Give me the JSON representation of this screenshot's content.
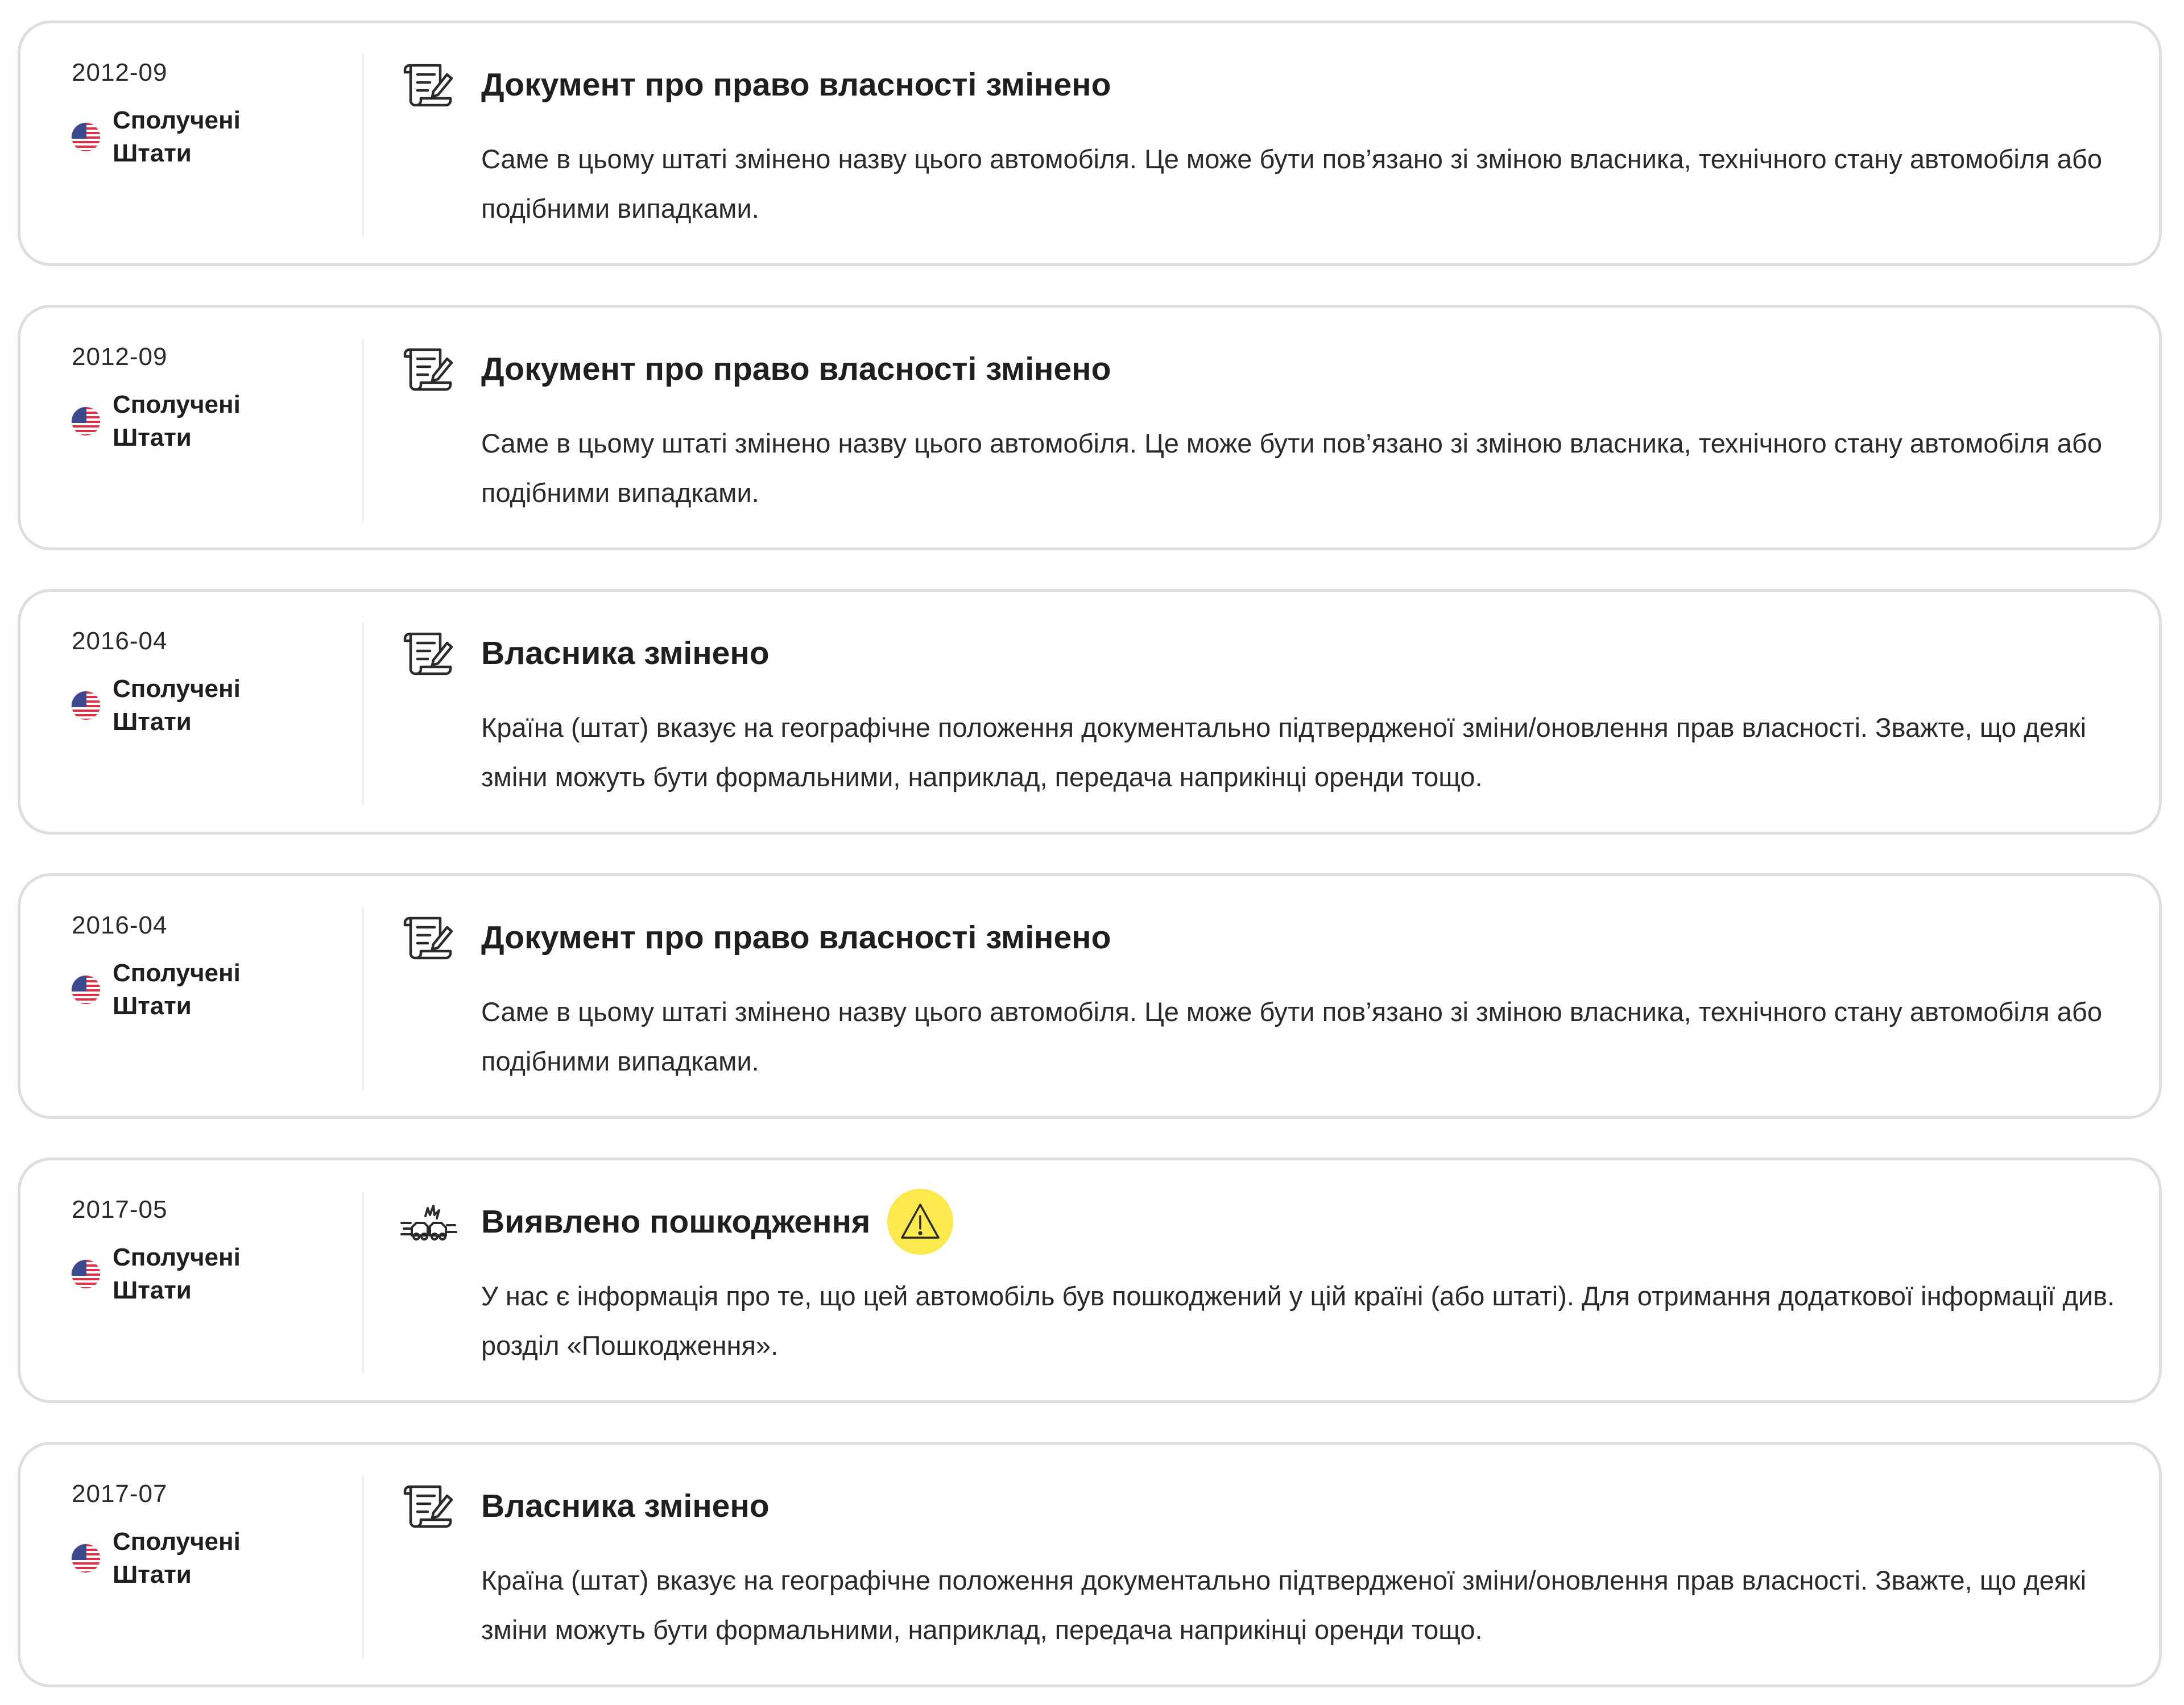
{
  "events": [
    {
      "date": "2012-09",
      "country": "Сполучені Штати",
      "icon": "title-document-icon",
      "title": "Документ про право власності змінено",
      "description": "Саме в цьому штаті змінено назву цього автомобіля. Це може бути пов’язано зі зміною власника, технічного стану автомобіля або подібними випадками."
    },
    {
      "date": "2012-09",
      "country": "Сполучені Штати",
      "icon": "title-document-icon",
      "title": "Документ про право власності змінено",
      "description": "Саме в цьому штаті змінено назву цього автомобіля. Це може бути пов’язано зі зміною власника, технічного стану автомобіля або подібними випадками."
    },
    {
      "date": "2016-04",
      "country": "Сполучені Штати",
      "icon": "title-document-icon",
      "title": "Власника змінено",
      "description": "Країна (штат) вказує на географічне положення документально підтвердженої зміни/оновлення прав власності. Зважте, що деякі зміни можуть бути формальними, наприклад, передача наприкінці оренди тощо."
    },
    {
      "date": "2016-04",
      "country": "Сполучені Штати",
      "icon": "title-document-icon",
      "title": "Документ про право власності змінено",
      "description": "Саме в цьому штаті змінено назву цього автомобіля. Це може бути пов’язано зі зміною власника, технічного стану автомобіля або подібними випадками."
    },
    {
      "date": "2017-05",
      "country": "Сполучені Штати",
      "icon": "car-collision-icon",
      "title": "Виявлено пошкодження",
      "warning": true,
      "description": "У нас є інформація про те, що цей автомобіль був пошкоджений у цій країні (або штаті). Для отримання додаткової інформації див. розділ «Пошкодження»."
    },
    {
      "date": "2017-07",
      "country": "Сполучені Штати",
      "icon": "title-document-icon",
      "title": "Власника змінено",
      "description": "Країна (штат) вказує на географічне положення документально підтвердженої зміни/оновлення прав власності. Зважте, що деякі зміни можуть бути формальними, наприклад, передача наприкінці оренди тощо."
    }
  ],
  "colors": {
    "card_border": "#dedede",
    "warning_badge": "#fbe94d",
    "text": "#1f1f1f"
  }
}
